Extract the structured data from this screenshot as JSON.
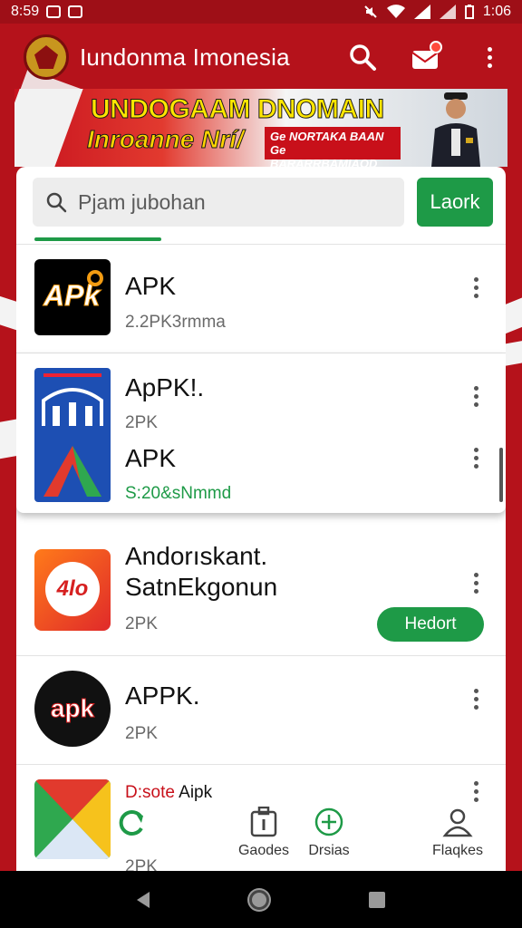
{
  "status_bar": {
    "time": "8:59",
    "clock": "1:06"
  },
  "app_bar": {
    "title": "Iundonma Imonesia"
  },
  "banner": {
    "line1": "UNDOGAAM DNOMAIN",
    "line2": "Inroanne Nrí/",
    "chip_line1": "Ge NORTAKA BAAN",
    "chip_line2": "Ge BARARRBAMIAOD"
  },
  "search": {
    "placeholder": "Pjam jubohan",
    "button": "Laork"
  },
  "apps": [
    {
      "title": "APK",
      "subtitle": "2.2PK3rmma"
    },
    {
      "title": "ApPK!.",
      "subtitle": "2PK"
    },
    {
      "title": "APK",
      "subtitle": "S:20&sNmmd"
    },
    {
      "title_line1": "Andorıskant.",
      "title_line2": "SatnEkgonun",
      "subtitle": "2PK",
      "action": "Hedort"
    },
    {
      "title": "APPK.",
      "subtitle": "2PK"
    },
    {
      "title_prefix": "D:sote",
      "title": "Aipk",
      "subtitle": "2PK"
    }
  ],
  "app_icon_texts": {
    "first": "APk",
    "third": "4lo",
    "fourth": "apk"
  },
  "bottom_nav": [
    {
      "label": "Gaodes",
      "icon": "info-box-icon"
    },
    {
      "label": "Drsias",
      "icon": "plus-circle-icon"
    },
    {
      "label": "Flaqkes",
      "icon": "person-icon"
    }
  ],
  "colors": {
    "primary_red": "#b5121b",
    "accent_green": "#1e9a47"
  }
}
